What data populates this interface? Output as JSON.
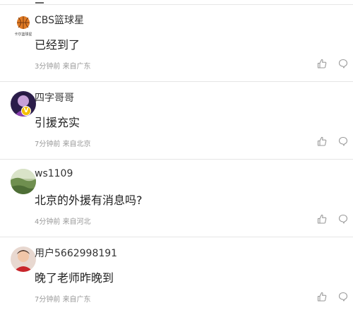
{
  "comments": [
    {
      "username": "CBS篮球星",
      "content": "已经到了",
      "time": "3分钟前",
      "location": "来自广东",
      "avatar": "basketball-logo-avatar",
      "avatar_caption": "卡尔篮球星",
      "verified": false
    },
    {
      "username": "四字哥哥",
      "content": "引援充实",
      "time": "7分钟前",
      "location": "来自北京",
      "avatar": "purple-portrait-avatar",
      "verified": true,
      "verified_mark": "V"
    },
    {
      "username": "ws1109",
      "content": "北京的外援有消息吗?",
      "time": "4分钟前",
      "location": "来自河北",
      "avatar": "green-landscape-avatar",
      "verified": false
    },
    {
      "username": "用户5662998191",
      "content": "晚了老师昨晚到",
      "time": "7分钟前",
      "location": "来自广东",
      "avatar": "red-portrait-avatar",
      "verified": false
    }
  ],
  "icons": {
    "like": "thumbs-up-icon",
    "reply": "comment-bubble-icon"
  },
  "colors": {
    "text_primary": "#222222",
    "username": "#333333",
    "meta": "#999999",
    "icon": "#9a9a9a",
    "divider": "#e5e5e5",
    "badge": "#f5c000"
  }
}
